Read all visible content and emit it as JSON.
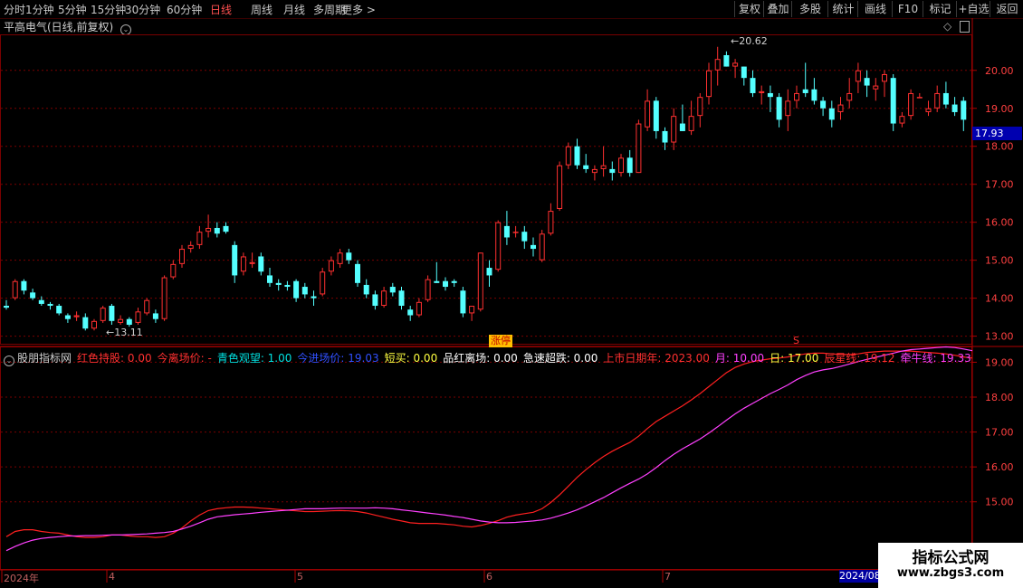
{
  "toolbar": {
    "periods": [
      "分时",
      "1分钟",
      "5分钟",
      "15分钟",
      "30分钟",
      "60分钟",
      "日线",
      "周线",
      "月线",
      "多周期",
      "更多 >"
    ],
    "active_period": "日线",
    "right_buttons": [
      "复权",
      "叠加",
      "多股",
      "统计",
      "画线",
      "F10",
      "标记",
      "+自选",
      "返回"
    ]
  },
  "stock_title": "平高电气(日线,前复权)",
  "price_axis": {
    "labels": [
      "20.00",
      "19.00",
      "18.00",
      "17.00",
      "16.00",
      "15.00",
      "14.00",
      "13.00"
    ]
  },
  "current_price": "17.93",
  "high_marker": "20.62",
  "low_marker": "13.11",
  "tags": {
    "zhangting": "涨停",
    "s_mark": "S"
  },
  "indicator": {
    "name": "股朋指标网",
    "legend": [
      {
        "label": "红色持股:",
        "value": "0.00",
        "color": "#ff3030"
      },
      {
        "label": "今离场价:",
        "value": "-",
        "color": "#ff3030"
      },
      {
        "label": "青色观望:",
        "value": "1.00",
        "color": "#00e0e0"
      },
      {
        "label": "今进场价:",
        "value": "19.03",
        "color": "#3050ff"
      },
      {
        "label": "短买:",
        "value": "0.00",
        "color": "#ffff40"
      },
      {
        "label": "品红离场:",
        "value": "0.00",
        "color": "#ffffff"
      },
      {
        "label": "急速超跌:",
        "value": "0.00",
        "color": "#ffffff"
      },
      {
        "label": "上市日期年:",
        "value": "2023.00",
        "color": "#ff3030"
      },
      {
        "label": "月:",
        "value": "10.00",
        "color": "#ff40ff"
      },
      {
        "label": "日:",
        "value": "17.00",
        "color": "#ffff40"
      },
      {
        "label": "辰星线:",
        "value": "19.12",
        "color": "#ff3030"
      },
      {
        "label": "牵牛线:",
        "value": "19.33",
        "color": "#ff40ff"
      }
    ],
    "axis_labels": [
      "19.00",
      "18.00",
      "17.00",
      "16.00",
      "15.00"
    ]
  },
  "date_axis": {
    "labels": [
      "2024年",
      "4",
      "5",
      "6",
      "7"
    ],
    "cursor": "2024/08"
  },
  "watermark": {
    "line1": "指标公式网",
    "line2": "www.zbgs3.com"
  },
  "colors": {
    "up": "#ff3030",
    "down": "#54ffff",
    "grid": "#7a0000",
    "line_red": "#ff2020",
    "line_magenta": "#ff40ff"
  },
  "chart_data": {
    "type": "candlestick",
    "candles": [
      [
        13.8,
        13.95,
        13.7,
        13.75
      ],
      [
        14.0,
        14.5,
        13.95,
        14.45
      ],
      [
        14.45,
        14.5,
        14.1,
        14.2
      ],
      [
        14.15,
        14.25,
        13.95,
        14.0
      ],
      [
        13.95,
        14.05,
        13.8,
        13.85
      ],
      [
        13.85,
        13.9,
        13.7,
        13.8
      ],
      [
        13.8,
        13.85,
        13.55,
        13.6
      ],
      [
        13.55,
        13.6,
        13.35,
        13.45
      ],
      [
        13.5,
        13.65,
        13.4,
        13.55
      ],
      [
        13.5,
        13.6,
        13.15,
        13.2
      ],
      [
        13.2,
        13.45,
        13.15,
        13.4
      ],
      [
        13.4,
        13.8,
        13.35,
        13.75
      ],
      [
        13.8,
        13.85,
        13.3,
        13.4
      ],
      [
        13.35,
        13.55,
        13.3,
        13.45
      ],
      [
        13.45,
        13.5,
        13.25,
        13.3
      ],
      [
        13.35,
        13.75,
        13.3,
        13.65
      ],
      [
        13.6,
        14.0,
        13.55,
        13.95
      ],
      [
        13.6,
        13.7,
        13.35,
        13.45
      ],
      [
        13.45,
        14.6,
        13.4,
        14.55
      ],
      [
        14.55,
        15.0,
        14.5,
        14.9
      ],
      [
        14.9,
        15.4,
        14.8,
        15.3
      ],
      [
        15.3,
        15.5,
        15.2,
        15.4
      ],
      [
        15.4,
        15.9,
        15.3,
        15.75
      ],
      [
        15.75,
        16.2,
        15.6,
        15.85
      ],
      [
        15.85,
        16.0,
        15.6,
        15.7
      ],
      [
        15.9,
        16.0,
        15.7,
        15.75
      ],
      [
        15.4,
        15.5,
        14.4,
        14.6
      ],
      [
        14.7,
        15.2,
        14.6,
        15.1
      ],
      [
        14.9,
        15.2,
        14.8,
        14.95
      ],
      [
        15.1,
        15.2,
        14.6,
        14.7
      ],
      [
        14.6,
        14.8,
        14.3,
        14.4
      ],
      [
        14.4,
        14.5,
        14.2,
        14.35
      ],
      [
        14.35,
        14.45,
        14.2,
        14.3
      ],
      [
        14.45,
        14.5,
        13.9,
        14.0
      ],
      [
        14.3,
        14.4,
        14.0,
        14.1
      ],
      [
        14.05,
        14.2,
        13.8,
        14.0
      ],
      [
        14.1,
        14.8,
        14.05,
        14.7
      ],
      [
        14.7,
        15.1,
        14.6,
        15.0
      ],
      [
        14.9,
        15.3,
        14.8,
        15.2
      ],
      [
        15.2,
        15.3,
        14.9,
        15.0
      ],
      [
        14.9,
        15.0,
        14.3,
        14.4
      ],
      [
        14.35,
        14.5,
        14.0,
        14.1
      ],
      [
        14.1,
        14.2,
        13.7,
        13.8
      ],
      [
        13.8,
        14.3,
        13.75,
        14.2
      ],
      [
        14.3,
        14.4,
        14.05,
        14.15
      ],
      [
        14.2,
        14.3,
        13.7,
        13.8
      ],
      [
        13.7,
        13.8,
        13.4,
        13.55
      ],
      [
        13.55,
        14.0,
        13.5,
        13.9
      ],
      [
        13.95,
        14.6,
        13.9,
        14.5
      ],
      [
        14.45,
        14.95,
        14.4,
        14.4
      ],
      [
        14.45,
        14.55,
        14.2,
        14.3
      ],
      [
        14.45,
        14.5,
        14.3,
        14.4
      ],
      [
        14.2,
        14.3,
        13.5,
        13.6
      ],
      [
        13.6,
        13.8,
        13.4,
        13.8
      ],
      [
        13.7,
        15.2,
        13.65,
        15.2
      ],
      [
        14.8,
        15.0,
        14.3,
        14.6
      ],
      [
        14.75,
        16.05,
        14.7,
        16.0
      ],
      [
        15.9,
        16.3,
        15.4,
        15.6
      ],
      [
        15.75,
        15.9,
        15.6,
        15.75
      ],
      [
        15.75,
        15.9,
        15.3,
        15.5
      ],
      [
        15.4,
        15.6,
        15.1,
        15.3
      ],
      [
        15.0,
        15.8,
        14.95,
        15.7
      ],
      [
        15.7,
        16.5,
        15.65,
        16.3
      ],
      [
        16.35,
        17.6,
        16.3,
        17.5
      ],
      [
        17.5,
        18.1,
        17.4,
        18.0
      ],
      [
        18.0,
        18.2,
        17.4,
        17.5
      ],
      [
        17.5,
        17.8,
        17.3,
        17.4
      ],
      [
        17.3,
        17.5,
        17.1,
        17.4
      ],
      [
        17.4,
        18.0,
        17.2,
        17.5
      ],
      [
        17.4,
        17.6,
        17.1,
        17.3
      ],
      [
        17.3,
        17.8,
        17.2,
        17.7
      ],
      [
        17.7,
        17.9,
        17.2,
        17.3
      ],
      [
        17.3,
        18.7,
        17.3,
        18.6
      ],
      [
        18.5,
        19.5,
        18.4,
        19.2
      ],
      [
        19.2,
        19.3,
        18.2,
        18.4
      ],
      [
        18.4,
        18.5,
        17.9,
        18.1
      ],
      [
        18.1,
        19.0,
        17.9,
        18.8
      ],
      [
        18.6,
        19.1,
        18.4,
        18.4
      ],
      [
        18.4,
        19.2,
        18.3,
        18.8
      ],
      [
        18.8,
        19.4,
        18.5,
        19.3
      ],
      [
        19.3,
        20.2,
        19.1,
        20.0
      ],
      [
        20.0,
        20.62,
        19.6,
        20.3
      ],
      [
        20.4,
        20.5,
        20.1,
        20.1
      ],
      [
        20.1,
        20.3,
        19.8,
        20.2
      ],
      [
        20.1,
        20.1,
        19.6,
        19.8
      ],
      [
        19.8,
        20.0,
        19.3,
        19.4
      ],
      [
        19.4,
        19.6,
        19.1,
        19.45
      ],
      [
        19.4,
        19.6,
        18.9,
        19.3
      ],
      [
        19.3,
        19.4,
        18.5,
        18.7
      ],
      [
        18.8,
        19.5,
        18.4,
        19.2
      ],
      [
        19.2,
        19.6,
        19.0,
        19.4
      ],
      [
        19.5,
        20.2,
        19.3,
        19.4
      ],
      [
        19.5,
        19.8,
        19.1,
        19.2
      ],
      [
        19.2,
        19.3,
        18.8,
        19.0
      ],
      [
        19.0,
        19.2,
        18.5,
        18.7
      ],
      [
        18.9,
        19.3,
        18.7,
        19.1
      ],
      [
        19.2,
        19.8,
        19.0,
        19.4
      ],
      [
        19.7,
        20.2,
        19.4,
        20.0
      ],
      [
        19.8,
        20.0,
        19.3,
        19.6
      ],
      [
        19.5,
        19.8,
        19.2,
        19.6
      ],
      [
        19.7,
        20.0,
        19.3,
        19.9
      ],
      [
        19.8,
        19.9,
        18.4,
        18.6
      ],
      [
        18.6,
        18.9,
        18.5,
        18.8
      ],
      [
        18.8,
        19.5,
        18.7,
        19.4
      ],
      [
        19.3,
        19.4,
        19.3,
        19.3
      ],
      [
        18.9,
        19.2,
        18.8,
        19.0
      ],
      [
        19.0,
        19.6,
        18.9,
        19.4
      ],
      [
        19.4,
        19.7,
        19.0,
        19.1
      ],
      [
        19.1,
        19.3,
        18.8,
        18.9
      ],
      [
        19.2,
        19.3,
        18.4,
        18.7
      ]
    ],
    "red_line": [
      14.0,
      14.15,
      14.2,
      14.2,
      14.15,
      14.12,
      14.1,
      14.05,
      14.0,
      13.98,
      13.98,
      14.0,
      14.05,
      14.05,
      14.02,
      14.0,
      14.0,
      13.98,
      14.0,
      14.1,
      14.25,
      14.45,
      14.62,
      14.75,
      14.8,
      14.83,
      14.85,
      14.85,
      14.84,
      14.82,
      14.8,
      14.78,
      14.76,
      14.74,
      14.72,
      14.72,
      14.73,
      14.74,
      14.75,
      14.74,
      14.72,
      14.68,
      14.62,
      14.56,
      14.5,
      14.45,
      14.4,
      14.38,
      14.38,
      14.38,
      14.36,
      14.34,
      14.3,
      14.28,
      14.32,
      14.38,
      14.46,
      14.56,
      14.62,
      14.66,
      14.7,
      14.8,
      14.98,
      15.2,
      15.45,
      15.7,
      15.92,
      16.12,
      16.3,
      16.45,
      16.58,
      16.7,
      16.88,
      17.1,
      17.3,
      17.45,
      17.6,
      17.75,
      17.92,
      18.1,
      18.3,
      18.5,
      18.7,
      18.85,
      18.95,
      19.02,
      19.06,
      19.1,
      19.12,
      19.15,
      19.2,
      19.24,
      19.26,
      19.26,
      19.24,
      19.22,
      19.22,
      19.24,
      19.28,
      19.3,
      19.32,
      19.32,
      19.32,
      19.32,
      19.3,
      19.28,
      19.26,
      19.24,
      19.2,
      19.15,
      19.12
    ],
    "magenta_line": [
      13.6,
      13.72,
      13.82,
      13.9,
      13.95,
      13.98,
      14.0,
      14.02,
      14.02,
      14.03,
      14.03,
      14.04,
      14.05,
      14.05,
      14.06,
      14.07,
      14.08,
      14.1,
      14.12,
      14.15,
      14.22,
      14.3,
      14.4,
      14.5,
      14.57,
      14.6,
      14.63,
      14.65,
      14.67,
      14.7,
      14.72,
      14.74,
      14.76,
      14.78,
      14.8,
      14.8,
      14.8,
      14.81,
      14.82,
      14.82,
      14.82,
      14.82,
      14.83,
      14.82,
      14.8,
      14.77,
      14.74,
      14.71,
      14.68,
      14.65,
      14.62,
      14.58,
      14.55,
      14.5,
      14.45,
      14.42,
      14.4,
      14.4,
      14.41,
      14.43,
      14.45,
      14.48,
      14.53,
      14.6,
      14.68,
      14.77,
      14.88,
      15.0,
      15.12,
      15.26,
      15.4,
      15.53,
      15.65,
      15.8,
      15.98,
      16.18,
      16.36,
      16.52,
      16.66,
      16.8,
      16.97,
      17.15,
      17.34,
      17.52,
      17.68,
      17.82,
      17.96,
      18.1,
      18.22,
      18.35,
      18.5,
      18.62,
      18.72,
      18.78,
      18.82,
      18.88,
      18.95,
      19.02,
      19.08,
      19.14,
      19.2,
      19.26,
      19.32,
      19.36,
      19.38,
      19.4,
      19.42,
      19.44,
      19.42,
      19.38,
      19.33
    ],
    "price_ylim": [
      12.8,
      20.9
    ],
    "indicator_ylim": [
      13.1,
      19.4
    ]
  }
}
